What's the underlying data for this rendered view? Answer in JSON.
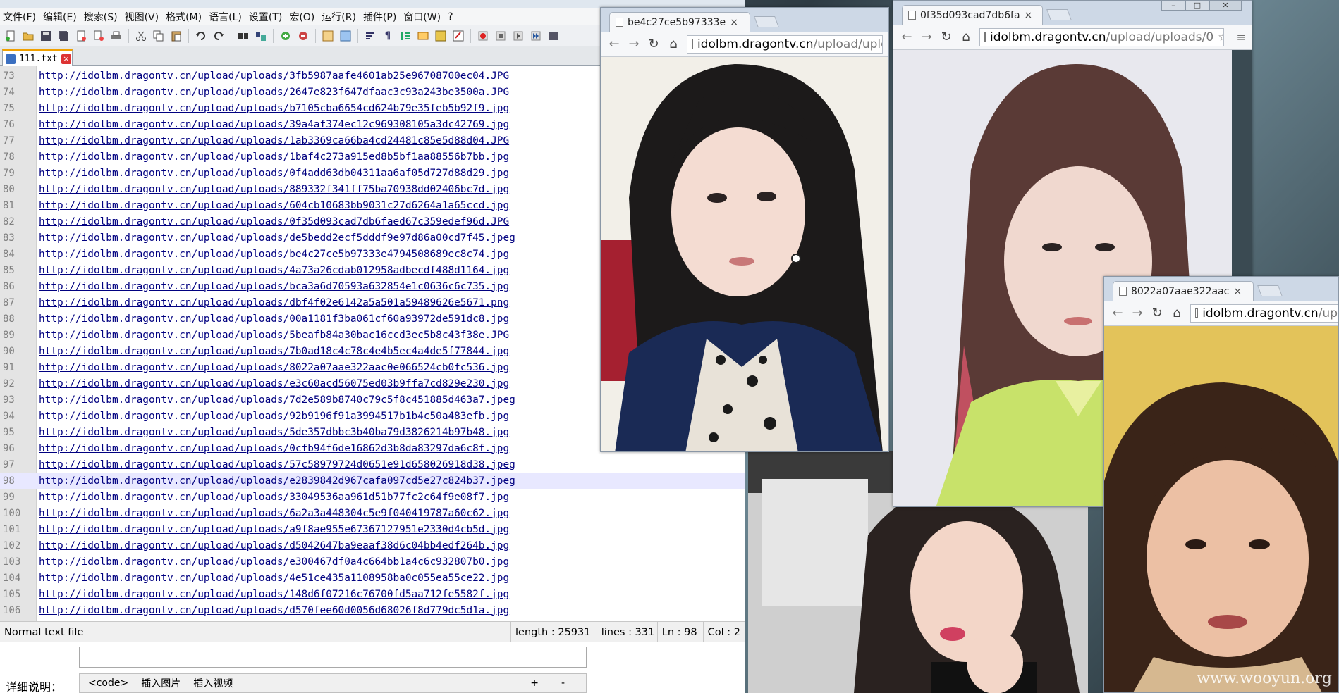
{
  "npp": {
    "menu": [
      "文件(F)",
      "编辑(E)",
      "搜索(S)",
      "视图(V)",
      "格式(M)",
      "语言(L)",
      "设置(T)",
      "宏(O)",
      "运行(R)",
      "插件(P)",
      "窗口(W)",
      "?"
    ],
    "tab_label": "111.txt",
    "current_line": 98,
    "lines": [
      {
        "n": "73",
        "text": "http://idolbm.dragontv.cn/upload/uploads/3fb5987aafe4601ab25e96708700ec04.JPG"
      },
      {
        "n": "74",
        "text": "http://idolbm.dragontv.cn/upload/uploads/2647e823f647dfaac3c93a243be3500a.JPG"
      },
      {
        "n": "75",
        "text": "http://idolbm.dragontv.cn/upload/uploads/b7105cba6654cd624b79e35feb5b92f9.jpg"
      },
      {
        "n": "76",
        "text": "http://idolbm.dragontv.cn/upload/uploads/39a4af374ec12c969308105a3dc42769.jpg"
      },
      {
        "n": "77",
        "text": "http://idolbm.dragontv.cn/upload/uploads/1ab3369ca66ba4cd24481c85e5d88d04.JPG"
      },
      {
        "n": "78",
        "text": "http://idolbm.dragontv.cn/upload/uploads/1baf4c273a915ed8b5bf1aa88556b7bb.jpg"
      },
      {
        "n": "79",
        "text": "http://idolbm.dragontv.cn/upload/uploads/0f4add63db04311aa6af05d727d88d29.jpg"
      },
      {
        "n": "80",
        "text": "http://idolbm.dragontv.cn/upload/uploads/889332f341ff75ba70938dd02406bc7d.jpg"
      },
      {
        "n": "81",
        "text": "http://idolbm.dragontv.cn/upload/uploads/604cb10683bb9031c27d6264a1a65ccd.jpg"
      },
      {
        "n": "82",
        "text": "http://idolbm.dragontv.cn/upload/uploads/0f35d093cad7db6faed67c359edef96d.JPG"
      },
      {
        "n": "83",
        "text": "http://idolbm.dragontv.cn/upload/uploads/de5bedd2ecf5dddf9e97d86a00cd7f45.jpeg"
      },
      {
        "n": "84",
        "text": "http://idolbm.dragontv.cn/upload/uploads/be4c27ce5b97333e4794508689ec8c74.jpg"
      },
      {
        "n": "85",
        "text": "http://idolbm.dragontv.cn/upload/uploads/4a73a26cdab012958adbecdf488d1164.jpg"
      },
      {
        "n": "86",
        "text": "http://idolbm.dragontv.cn/upload/uploads/bca3a6d70593a632854e1c0636c6c735.jpg"
      },
      {
        "n": "87",
        "text": "http://idolbm.dragontv.cn/upload/uploads/dbf4f02e6142a5a501a59489626e5671.png"
      },
      {
        "n": "88",
        "text": "http://idolbm.dragontv.cn/upload/uploads/00a1181f3ba061cf60a93972de591dc8.jpg"
      },
      {
        "n": "89",
        "text": "http://idolbm.dragontv.cn/upload/uploads/5beafb84a30bac16ccd3ec5b8c43f38e.JPG"
      },
      {
        "n": "90",
        "text": "http://idolbm.dragontv.cn/upload/uploads/7b0ad18c4c78c4e4b5ec4a4de5f77844.jpg"
      },
      {
        "n": "91",
        "text": "http://idolbm.dragontv.cn/upload/uploads/8022a07aae322aac0e066524cb0fc536.jpg"
      },
      {
        "n": "92",
        "text": "http://idolbm.dragontv.cn/upload/uploads/e3c60acd56075ed03b9ffa7cd829e230.jpg"
      },
      {
        "n": "93",
        "text": "http://idolbm.dragontv.cn/upload/uploads/7d2e589b8740c79c5f8c451885d463a7.jpeg"
      },
      {
        "n": "94",
        "text": "http://idolbm.dragontv.cn/upload/uploads/92b9196f91a3994517b1b4c50a483efb.jpg"
      },
      {
        "n": "95",
        "text": "http://idolbm.dragontv.cn/upload/uploads/5de357dbbc3b40ba79d3826214b97b48.jpg"
      },
      {
        "n": "96",
        "text": "http://idolbm.dragontv.cn/upload/uploads/0cfb94f6de16862d3b8da83297da6c8f.jpg"
      },
      {
        "n": "97",
        "text": "http://idolbm.dragontv.cn/upload/uploads/57c58979724d0651e91d658026918d38.jpeg"
      },
      {
        "n": "98",
        "text": "http://idolbm.dragontv.cn/upload/uploads/e2839842d967cafa097cd5e27c824b37.jpeg"
      },
      {
        "n": "99",
        "text": "http://idolbm.dragontv.cn/upload/uploads/33049536aa961d51b77fc2c64f9e08f7.jpg"
      },
      {
        "n": "100",
        "text": "http://idolbm.dragontv.cn/upload/uploads/6a2a3a448304c5e9f040419787a60c62.jpg"
      },
      {
        "n": "101",
        "text": "http://idolbm.dragontv.cn/upload/uploads/a9f8ae955e67367127951e2330d4cb5d.jpg"
      },
      {
        "n": "102",
        "text": "http://idolbm.dragontv.cn/upload/uploads/d5042647ba9eaaf38d6c04bb4edf264b.jpg"
      },
      {
        "n": "103",
        "text": "http://idolbm.dragontv.cn/upload/uploads/e300467df0a4c664bb1a4c6c932807b0.jpg"
      },
      {
        "n": "104",
        "text": "http://idolbm.dragontv.cn/upload/uploads/4e51ce435a1108958ba0c055ea55ce22.jpg"
      },
      {
        "n": "105",
        "text": "http://idolbm.dragontv.cn/upload/uploads/148d6f07216c76700fd5aa712fe5582f.jpg"
      },
      {
        "n": "106",
        "text": "http://idolbm.dragontv.cn/upload/uploads/d570fee60d0056d68026f8d779dc5d1a.jpg"
      }
    ],
    "status": {
      "file_type": "Normal text file",
      "length": "length : 25931",
      "lines": "lines : 331",
      "ln": "Ln : 98",
      "col": "Col : 2"
    }
  },
  "below": {
    "detail_label": "详细说明：",
    "code_btn": "<code>",
    "insert_image": "插入图片",
    "insert_video": "插入视频",
    "plus": "+",
    "minus": "-"
  },
  "browsers": [
    {
      "tab_title": "be4c27ce5b97333e",
      "host": "idolbm.dragontv.cn",
      "path": "/upload/uploa"
    },
    {
      "tab_title": "0f35d093cad7db6fa",
      "host": "idolbm.dragontv.cn",
      "path": "/upload/uploads/0"
    },
    {
      "tab_title": "8022a07aae322aac",
      "host": "idolbm.dragontv.cn",
      "path": "/up"
    }
  ],
  "watermark": "www.wooyun.org",
  "colors": {
    "link": "#000080",
    "current_line": "#e8e8ff",
    "tab_accent": "#f0a000"
  }
}
